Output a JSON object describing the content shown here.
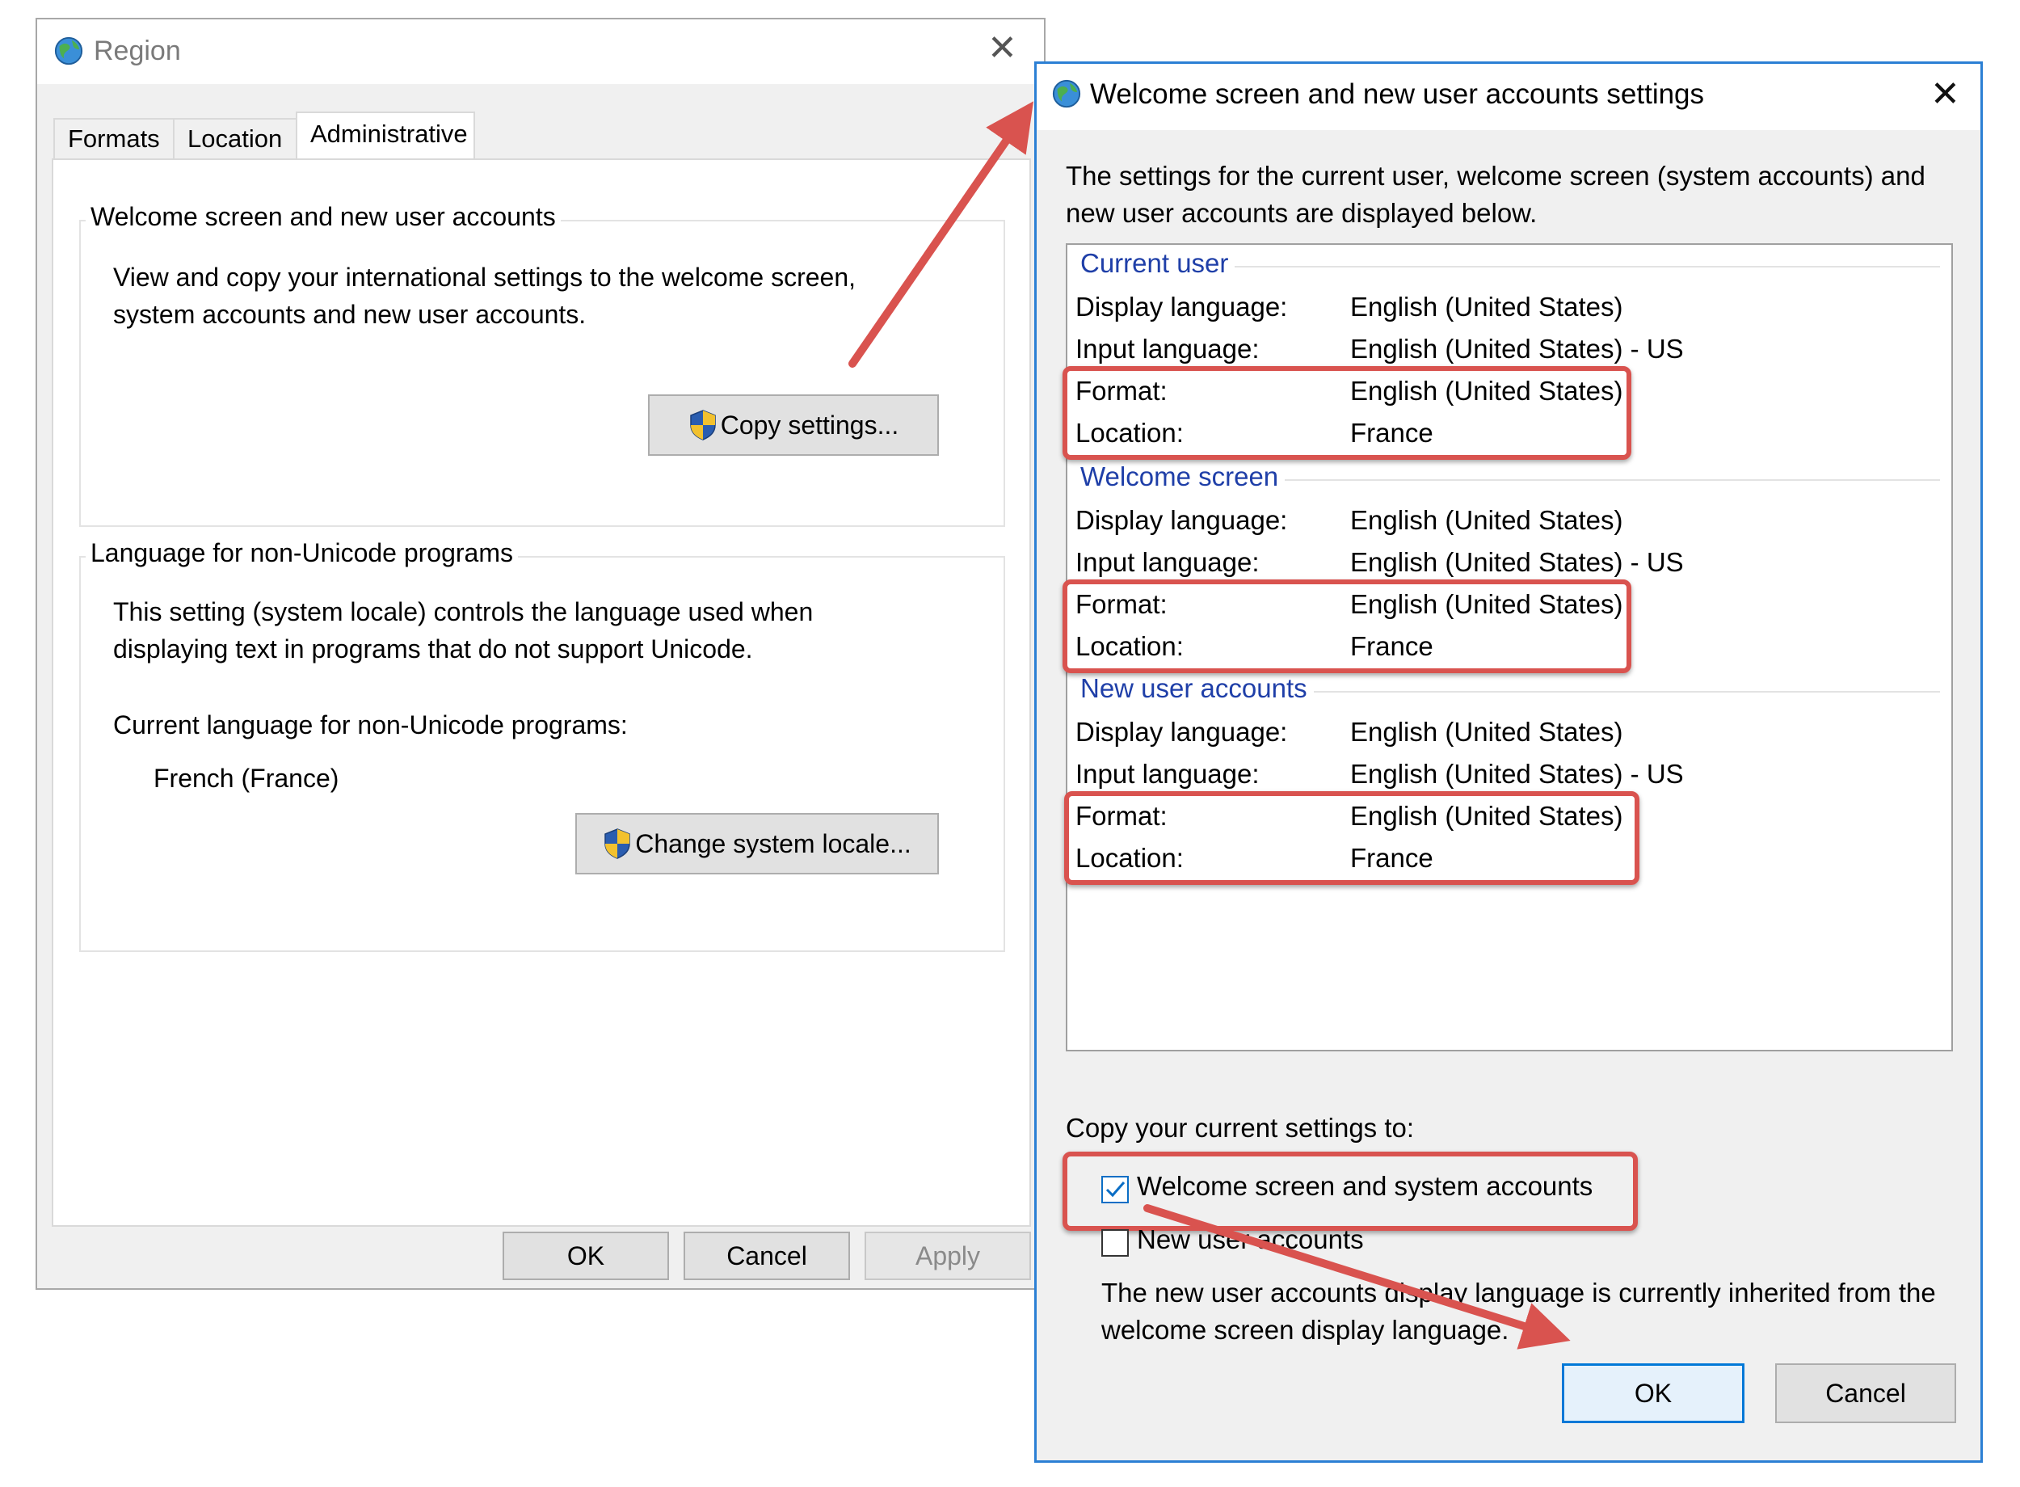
{
  "region_window": {
    "title": "Region",
    "tabs": [
      "Formats",
      "Location",
      "Administrative"
    ],
    "active_tab": "Administrative",
    "welcome_group": {
      "legend": "Welcome screen and new user accounts",
      "description_line1": "View and copy your international settings to the welcome screen,",
      "description_line2": "system accounts and new user accounts.",
      "button_label": "Copy settings..."
    },
    "non_unicode_group": {
      "legend": "Language for non-Unicode programs",
      "description_line1": "This setting (system locale) controls the language used when",
      "description_line2": "displaying text in programs that do not support Unicode.",
      "current_label": "Current language for non-Unicode programs:",
      "current_value": "French (France)",
      "button_label": "Change system locale..."
    },
    "buttons": {
      "ok": "OK",
      "cancel": "Cancel",
      "apply": "Apply"
    }
  },
  "welcome_dialog": {
    "title": "Welcome screen and new user accounts settings",
    "intro_line1": "The settings for the current user, welcome screen (system accounts) and",
    "intro_line2": "new user accounts are displayed below.",
    "sections": [
      {
        "heading": "Current user",
        "rows": [
          {
            "label": "Display language:",
            "value": "English (United States)"
          },
          {
            "label": "Input language:",
            "value": "English (United States) - US"
          },
          {
            "label": "Format:",
            "value": "English (United States)"
          },
          {
            "label": "Location:",
            "value": "France"
          }
        ]
      },
      {
        "heading": "Welcome screen",
        "rows": [
          {
            "label": "Display language:",
            "value": "English (United States)"
          },
          {
            "label": "Input language:",
            "value": "English (United States) - US"
          },
          {
            "label": "Format:",
            "value": "English (United States)"
          },
          {
            "label": "Location:",
            "value": "France"
          }
        ]
      },
      {
        "heading": "New user accounts",
        "rows": [
          {
            "label": "Display language:",
            "value": "English (United States)"
          },
          {
            "label": "Input language:",
            "value": "English (United States) - US"
          },
          {
            "label": "Format:",
            "value": "English (United States)"
          },
          {
            "label": "Location:",
            "value": "France"
          }
        ]
      }
    ],
    "copy_to_label": "Copy your current settings to:",
    "checkbox_welcome": {
      "label": "Welcome screen and system accounts",
      "checked": true
    },
    "checkbox_new_users": {
      "label": "New user accounts",
      "checked": false
    },
    "note_line1": "The new user accounts display language is currently inherited from the",
    "note_line2": "welcome screen display language.",
    "buttons": {
      "ok": "OK",
      "cancel": "Cancel"
    }
  },
  "colors": {
    "highlight": "#d9534f",
    "section_heading": "#1f3fa8",
    "dialog_border": "#2b7fd4"
  }
}
